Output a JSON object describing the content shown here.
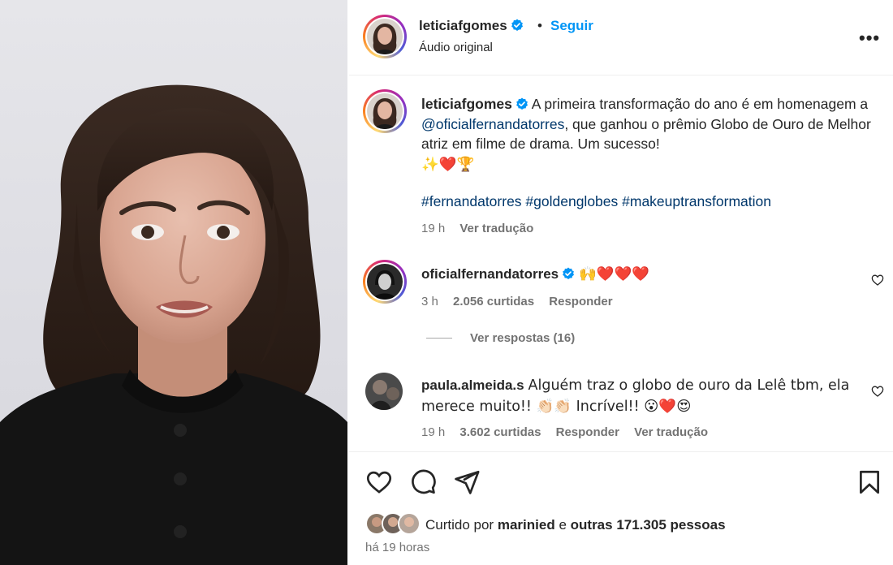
{
  "post_header": {
    "username": "leticiafgomes",
    "dot": "•",
    "follow_label": "Seguir",
    "audio_label": "Áudio original",
    "more_label": "•••"
  },
  "caption": {
    "username": "leticiafgomes",
    "text_before": "A primeira transformação do ano é em homenagem a ",
    "mention": "@oficialfernandatorres",
    "text_after": ", que ganhou o prêmio Globo de Ouro de Melhor atriz em filme de drama. Um sucesso!",
    "emojis": "✨❤️🏆",
    "hashtags": "#fernandatorres #goldenglobes #makeuptransformation",
    "time": "19 h",
    "translate": "Ver tradução"
  },
  "comments": [
    {
      "username": "oficialfernandatorres",
      "verified": true,
      "text": "🙌❤️❤️❤️",
      "time": "3 h",
      "likes": "2.056 curtidas",
      "reply": "Responder",
      "view_replies": "Ver respostas (16)"
    },
    {
      "username": "paula.almeida.s",
      "verified": false,
      "text": "Alguém traz o globo de ouro da Lelê tbm, ela merece muito!! 👏🏻👏🏻 Incrível!! 😮❤️😍",
      "time": "19 h",
      "likes": "3.602 curtidas",
      "reply": "Responder",
      "translate": "Ver tradução"
    }
  ],
  "likes_line": {
    "prefix": "Curtido por",
    "user": "marinied",
    "connector": "e",
    "others": "outras 171.305 pessoas"
  },
  "post_time": "há 19 horas",
  "colors": {
    "link": "#0095f6",
    "text": "#262626",
    "muted": "#737373",
    "heart": "#ed4956"
  },
  "icons": [
    "verified-icon",
    "more-icon",
    "heart-icon",
    "comment-icon",
    "share-icon",
    "save-icon"
  ]
}
